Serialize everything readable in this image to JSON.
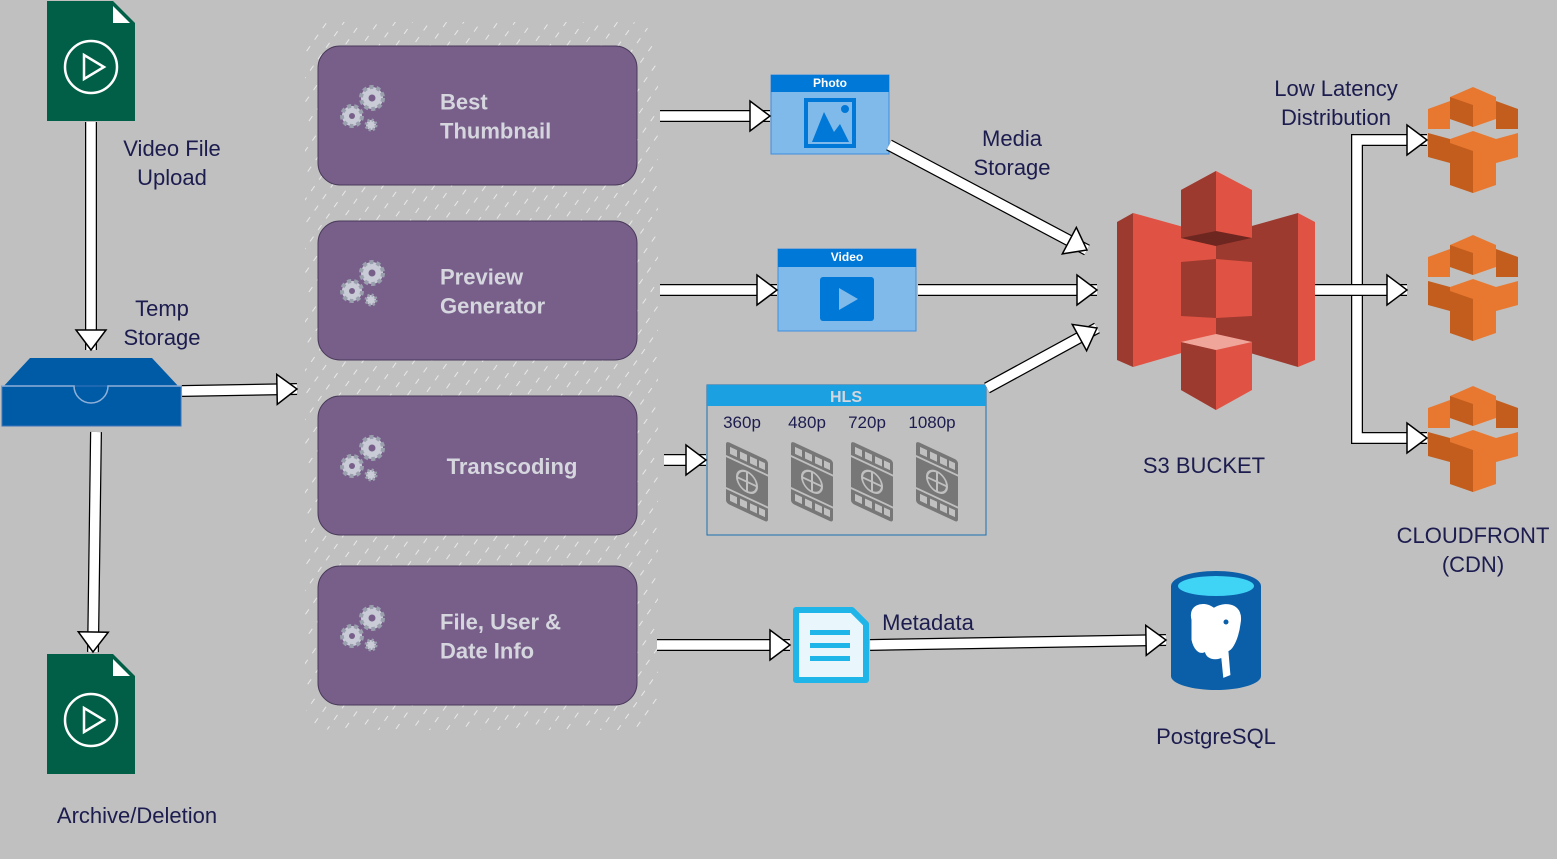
{
  "colors": {
    "background": "#c0c0c0",
    "process_box": "#775f8a",
    "s3": "#e05243",
    "cloudfront": "#e8782f",
    "file": "#005f46",
    "temp_storage": "#005ba7",
    "media_card": "#7fbaea",
    "media_header": "#0078d7",
    "hls_header": "#1ba1e2",
    "postgres": "#0b5fa8",
    "metadata": "#1fb5e8",
    "label_text": "#1c1c4f"
  },
  "labels": {
    "video_upload": [
      "Video File",
      "Upload"
    ],
    "temp_storage": [
      "Temp",
      "Storage"
    ],
    "archive": "Archive/Deletion",
    "media_storage": [
      "Media",
      "Storage"
    ],
    "low_latency": [
      "Low Latency",
      "Distribution"
    ],
    "s3": "S3 BUCKET",
    "cloudfront": [
      "CLOUDFRONT",
      "(CDN)"
    ],
    "metadata": "Metadata",
    "postgres": "PostgreSQL"
  },
  "processes": [
    {
      "lines": [
        "Best",
        "Thumbnail"
      ],
      "icon": "gears-icon"
    },
    {
      "lines": [
        "Preview",
        "Generator"
      ],
      "icon": "gears-icon"
    },
    {
      "lines": [
        "Transcoding"
      ],
      "icon": "gears-icon"
    },
    {
      "lines": [
        "File, User &",
        "Date Info"
      ],
      "icon": "gears-icon"
    }
  ],
  "outputs": {
    "photo": {
      "title": "Photo",
      "icon": "image-icon"
    },
    "video": {
      "title": "Video",
      "icon": "play-icon"
    },
    "hls": {
      "title": "HLS",
      "resolutions": [
        "360p",
        "480p",
        "720p",
        "1080p"
      ],
      "icon": "film-icon"
    }
  }
}
